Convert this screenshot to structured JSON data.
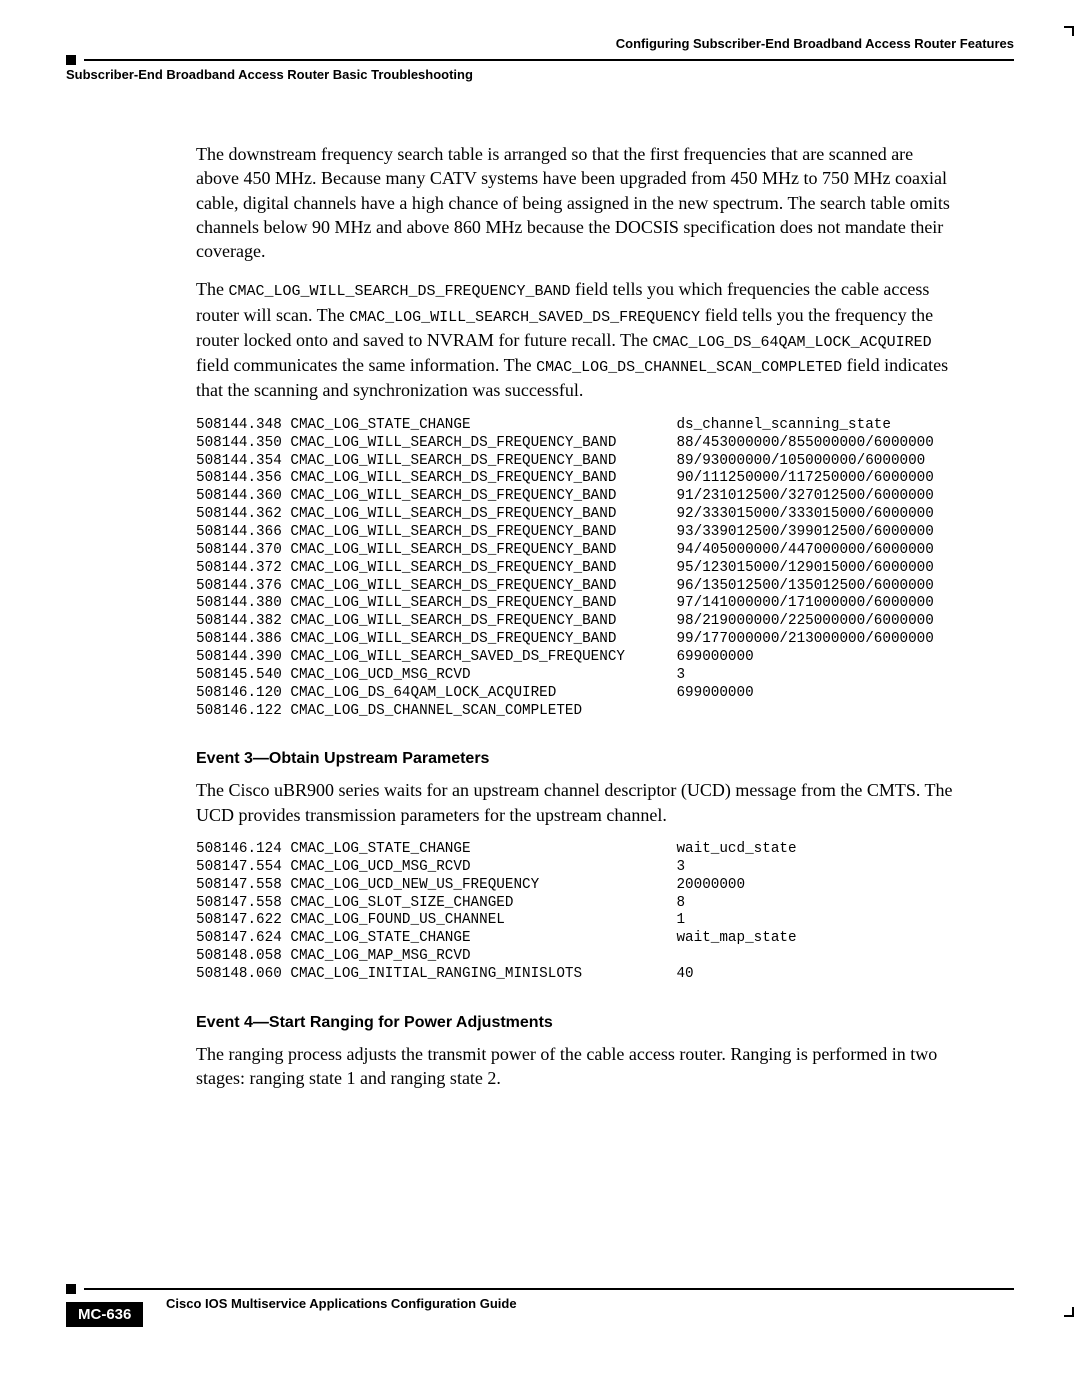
{
  "header": {
    "right": "Configuring Subscriber-End Broadband Access Router Features",
    "left": "Subscriber-End Broadband Access Router Basic Troubleshooting"
  },
  "body": {
    "p1": "The downstream frequency search table is arranged so that the first frequencies that are scanned are above 450 MHz. Because many CATV systems have been upgraded from 450 MHz to 750 MHz coaxial cable, digital channels have a high chance of being assigned in the new spectrum. The search table omits channels below 90 MHz and above 860 MHz because the DOCSIS specification does not mandate their coverage.",
    "p2a": "The ",
    "p2c1": "CMAC_LOG_WILL_SEARCH_DS_FREQUENCY_BAND",
    "p2b": " field tells you which frequencies the cable access router will scan. The ",
    "p2c2": "CMAC_LOG_WILL_SEARCH_SAVED_DS_FREQUENCY",
    "p2c": " field tells you the frequency the router locked onto and saved to NVRAM for future recall. The ",
    "p2c3": "CMAC_LOG_DS_64QAM_LOCK_ACQUIRED",
    "p2d": " field communicates the same information. The ",
    "p2c4": "CMAC_LOG_DS_CHANNEL_SCAN_COMPLETED",
    "p2e": " field indicates that the scanning and synchronization was successful.",
    "log1": "508144.348 CMAC_LOG_STATE_CHANGE                        ds_channel_scanning_state\n508144.350 CMAC_LOG_WILL_SEARCH_DS_FREQUENCY_BAND       88/453000000/855000000/6000000\n508144.354 CMAC_LOG_WILL_SEARCH_DS_FREQUENCY_BAND       89/93000000/105000000/6000000\n508144.356 CMAC_LOG_WILL_SEARCH_DS_FREQUENCY_BAND       90/111250000/117250000/6000000\n508144.360 CMAC_LOG_WILL_SEARCH_DS_FREQUENCY_BAND       91/231012500/327012500/6000000\n508144.362 CMAC_LOG_WILL_SEARCH_DS_FREQUENCY_BAND       92/333015000/333015000/6000000\n508144.366 CMAC_LOG_WILL_SEARCH_DS_FREQUENCY_BAND       93/339012500/399012500/6000000\n508144.370 CMAC_LOG_WILL_SEARCH_DS_FREQUENCY_BAND       94/405000000/447000000/6000000\n508144.372 CMAC_LOG_WILL_SEARCH_DS_FREQUENCY_BAND       95/123015000/129015000/6000000\n508144.376 CMAC_LOG_WILL_SEARCH_DS_FREQUENCY_BAND       96/135012500/135012500/6000000\n508144.380 CMAC_LOG_WILL_SEARCH_DS_FREQUENCY_BAND       97/141000000/171000000/6000000\n508144.382 CMAC_LOG_WILL_SEARCH_DS_FREQUENCY_BAND       98/219000000/225000000/6000000\n508144.386 CMAC_LOG_WILL_SEARCH_DS_FREQUENCY_BAND       99/177000000/213000000/6000000\n508144.390 CMAC_LOG_WILL_SEARCH_SAVED_DS_FREQUENCY      699000000\n508145.540 CMAC_LOG_UCD_MSG_RCVD                        3\n508146.120 CMAC_LOG_DS_64QAM_LOCK_ACQUIRED              699000000\n508146.122 CMAC_LOG_DS_CHANNEL_SCAN_COMPLETED",
    "event3_title": "Event  3—Obtain Upstream Parameters",
    "event3_p": "The Cisco uBR900 series waits for an upstream channel descriptor (UCD) message from the CMTS. The UCD provides transmission parameters for the upstream channel.",
    "log2": "508146.124 CMAC_LOG_STATE_CHANGE                        wait_ucd_state\n508147.554 CMAC_LOG_UCD_MSG_RCVD                        3\n508147.558 CMAC_LOG_UCD_NEW_US_FREQUENCY                20000000\n508147.558 CMAC_LOG_SLOT_SIZE_CHANGED                   8\n508147.622 CMAC_LOG_FOUND_US_CHANNEL                    1\n508147.624 CMAC_LOG_STATE_CHANGE                        wait_map_state\n508148.058 CMAC_LOG_MAP_MSG_RCVD\n508148.060 CMAC_LOG_INITIAL_RANGING_MINISLOTS           40",
    "event4_title": "Event  4—Start Ranging for Power Adjustments",
    "event4_p": "The ranging process adjusts the transmit power of the cable access router. Ranging is performed in two stages: ranging state 1 and ranging state 2."
  },
  "footer": {
    "guide": "Cisco IOS Multiservice Applications Configuration Guide",
    "page": "MC-636"
  }
}
